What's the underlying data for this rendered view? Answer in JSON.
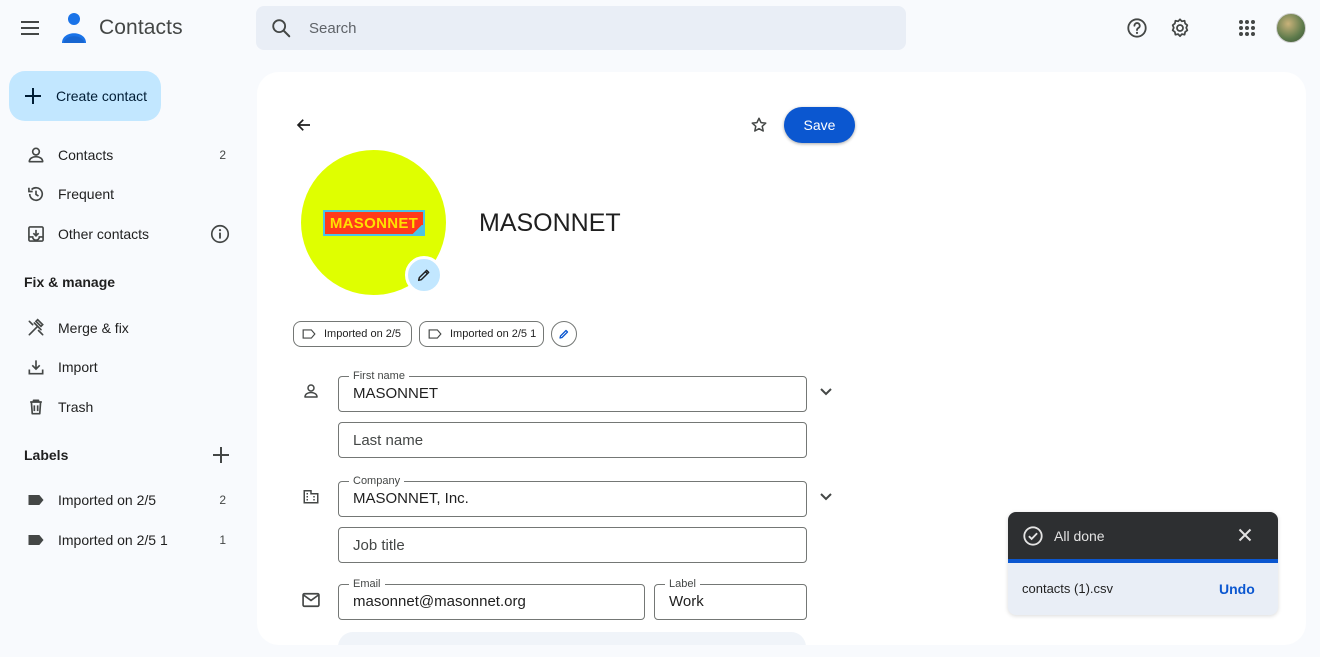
{
  "app": {
    "title": "Contacts"
  },
  "search": {
    "placeholder": "Search"
  },
  "topbar_icons": [
    "help-icon",
    "settings-icon",
    "apps-grid-icon",
    "account-avatar"
  ],
  "sidebar": {
    "create_label": "Create contact",
    "items": [
      {
        "label": "Contacts",
        "count": "2",
        "icon": "person-icon"
      },
      {
        "label": "Frequent",
        "count": "",
        "icon": "history-icon"
      },
      {
        "label": "Other contacts",
        "count": "",
        "icon": "archive-icon"
      }
    ],
    "fix_title": "Fix & manage",
    "fix_items": [
      {
        "label": "Merge & fix",
        "icon": "merge-tools-icon"
      },
      {
        "label": "Import",
        "icon": "download-icon"
      },
      {
        "label": "Trash",
        "icon": "trash-icon"
      }
    ],
    "labels_title": "Labels",
    "labels": [
      {
        "label": "Imported on 2/5",
        "count": "2"
      },
      {
        "label": "Imported on 2/5 1",
        "count": "1"
      }
    ]
  },
  "editor": {
    "save_label": "Save",
    "contact_name": "MASONNET",
    "logo_text": "MASONNET",
    "label_chips": [
      "Imported on 2/5",
      "Imported on 2/5 1"
    ],
    "first_name": {
      "label": "First name",
      "value": "MASONNET"
    },
    "last_name": {
      "placeholder": "Last name"
    },
    "company": {
      "label": "Company",
      "value": "MASONNET, Inc."
    },
    "job_title": {
      "placeholder": "Job title"
    },
    "email": {
      "label": "Email",
      "value": "masonnet@masonnet.org"
    },
    "email_type": {
      "label": "Label",
      "value": "Work"
    }
  },
  "toast": {
    "title": "All done",
    "file": "contacts (1).csv",
    "undo_label": "Undo"
  },
  "colors": {
    "accent": "#0b57d0",
    "create_bg": "#c2e7ff",
    "photo_bg": "#dfff00",
    "logo_red": "#ff3b1a",
    "logo_yellow": "#ffe000"
  }
}
